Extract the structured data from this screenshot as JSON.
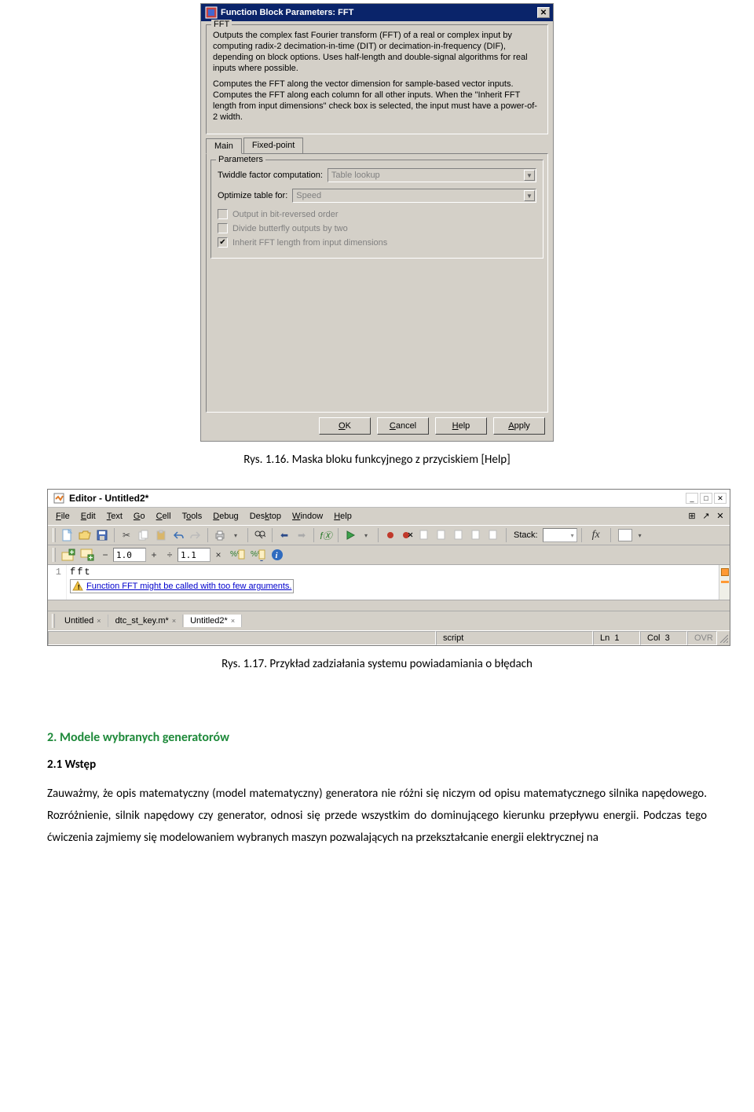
{
  "dialog": {
    "title": "Function Block Parameters: FFT",
    "groupLabel": "FFT",
    "desc1": "Outputs the complex fast Fourier transform (FFT) of a real or complex input by computing radix-2 decimation-in-time (DIT) or decimation-in-frequency (DIF), depending on block options. Uses half-length and double-signal algorithms for real inputs where possible.",
    "desc2": "Computes the FFT along the vector dimension for sample-based vector inputs. Computes the FFT along each column for all other inputs. When the \"Inherit FFT length from input dimensions\" check box is selected, the input must have a power-of-2 width.",
    "tab_main": "Main",
    "tab_fixed": "Fixed-point",
    "paramsLegend": "Parameters",
    "twiddleLabel": "Twiddle factor computation:",
    "twiddleValue": "Table lookup",
    "optLabel": "Optimize table for:",
    "optValue": "Speed",
    "chk1": "Output in bit-reversed order",
    "chk2": "Divide butterfly outputs by two",
    "chk3": "Inherit FFT length from input dimensions",
    "btn_ok_pre": "",
    "btn_ok_u": "O",
    "btn_ok_post": "K",
    "btn_cancel_pre": "",
    "btn_cancel_u": "C",
    "btn_cancel_post": "ancel",
    "btn_help_pre": "",
    "btn_help_u": "H",
    "btn_help_post": "elp",
    "btn_apply_pre": "",
    "btn_apply_u": "A",
    "btn_apply_post": "pply"
  },
  "caption1": "Rys. 1.16. Maska bloku funkcyjnego z przyciskiem [Help]",
  "editor": {
    "title": "Editor - Untitled2*",
    "menus": {
      "file_u": "F",
      "file": "ile",
      "edit_u": "E",
      "edit": "dit",
      "text_u": "T",
      "text": "ext",
      "go_u": "G",
      "go": "o",
      "cell_u": "C",
      "cell": "ell",
      "tools_pre": "T",
      "tools_u": "o",
      "tools_post": "ols",
      "debug_u": "D",
      "debug": "ebug",
      "desktop_pre": "Des",
      "desktop_u": "k",
      "desktop_post": "top",
      "window_u": "W",
      "window": "indow",
      "help_u": "H",
      "help": "elp"
    },
    "stackLabel": "Stack:",
    "fx": "fx",
    "cell_val1": "1.0",
    "cell_val2": "1.1",
    "gutter1": "1",
    "code_line1": "fft",
    "warn_text": "Function FFT might be called with too few arguments.",
    "doctabs": {
      "t1": "Untitled",
      "t2": "dtc_st_key.m*",
      "t3": "Untitled2*"
    },
    "status_script": "script",
    "status_ln": "Ln",
    "status_ln_v": "1",
    "status_col": "Col",
    "status_col_v": "3",
    "status_ovr": "OVR"
  },
  "caption2": "Rys. 1.17. Przykład zadziałania systemu powiadamiania o błędach",
  "doc": {
    "sec": "2. Modele wybranych generatorów",
    "sub": "2.1 Wstęp",
    "para": "Zauważmy, że opis matematyczny (model matematyczny) generatora nie różni się niczym od opisu matematycznego silnika napędowego. Rozróżnienie, silnik napędowy czy generator, odnosi się przede wszystkim do dominującego kierunku przepływu energii. Podczas tego ćwiczenia zajmiemy się modelowaniem wybranych maszyn pozwalających na przekształcanie energii elektrycznej na"
  }
}
